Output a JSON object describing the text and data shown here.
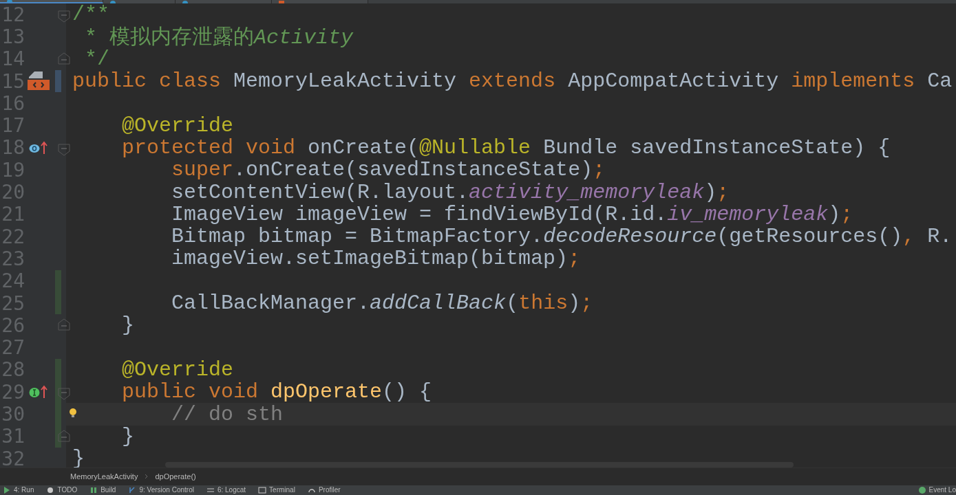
{
  "editor_tabs": [
    {
      "selected": true,
      "kind": "java"
    },
    {
      "selected": false,
      "kind": "java"
    },
    {
      "selected": false,
      "kind": "java"
    },
    {
      "selected": false,
      "kind": "xml"
    }
  ],
  "lines": [
    {
      "number": "12",
      "kind": "code",
      "added": false,
      "modified": false,
      "fold_start": true,
      "fold_end": false,
      "current": false,
      "tokens": [
        {
          "text": "/**",
          "kind": "doc"
        }
      ]
    },
    {
      "number": "13",
      "kind": "code",
      "added": false,
      "modified": false,
      "fold_start": false,
      "fold_end": false,
      "current": false,
      "tokens": [
        {
          "text": " * 模拟内存泄露的",
          "kind": "doc"
        },
        {
          "text": "Activity",
          "kind": "doc-italic"
        }
      ]
    },
    {
      "number": "14",
      "kind": "code",
      "added": false,
      "modified": false,
      "fold_start": false,
      "fold_end": true,
      "current": false,
      "tokens": [
        {
          "text": " */",
          "kind": "doc"
        }
      ]
    },
    {
      "number": "15",
      "kind": "class",
      "added": false,
      "modified": true,
      "fold_start": false,
      "fold_end": false,
      "current": false,
      "tokens": [
        {
          "text": "public class ",
          "kind": "keyword"
        },
        {
          "text": "MemoryLeakActivity ",
          "kind": "plain"
        },
        {
          "text": "extends ",
          "kind": "keyword"
        },
        {
          "text": "AppCompatActivity ",
          "kind": "plain"
        },
        {
          "text": "implements ",
          "kind": "keyword"
        },
        {
          "text": "Ca",
          "kind": "plain"
        }
      ]
    },
    {
      "number": "16",
      "kind": "code",
      "added": false,
      "modified": false,
      "fold_start": false,
      "fold_end": false,
      "current": false
    },
    {
      "number": "17",
      "kind": "code",
      "added": false,
      "modified": false,
      "fold_start": false,
      "fold_end": false,
      "current": false,
      "tokens": [
        {
          "text": "    @Override",
          "kind": "annotation"
        }
      ]
    },
    {
      "number": "18",
      "kind": "overriding",
      "added": false,
      "modified": false,
      "fold_start": true,
      "fold_end": false,
      "current": false,
      "tokens": [
        {
          "text": "    protected void ",
          "kind": "keyword"
        },
        {
          "text": "onCreate(",
          "kind": "plain"
        },
        {
          "text": "@Nullable ",
          "kind": "annotation"
        },
        {
          "text": "Bundle savedInstanceState) {",
          "kind": "plain"
        }
      ]
    },
    {
      "number": "19",
      "kind": "code",
      "added": false,
      "modified": false,
      "fold_start": false,
      "fold_end": false,
      "current": false,
      "tokens": [
        {
          "text": "        super",
          "kind": "keyword"
        },
        {
          "text": ".onCreate(savedInstanceState)",
          "kind": "plain"
        },
        {
          "text": ";",
          "kind": "keyword"
        }
      ]
    },
    {
      "number": "20",
      "kind": "code",
      "added": false,
      "modified": false,
      "fold_start": false,
      "fold_end": false,
      "current": false,
      "tokens": [
        {
          "text": "        setContentView(R.layout.",
          "kind": "plain"
        },
        {
          "text": "activity_memoryleak",
          "kind": "field"
        },
        {
          "text": ")",
          "kind": "plain"
        },
        {
          "text": ";",
          "kind": "keyword"
        }
      ]
    },
    {
      "number": "21",
      "kind": "code",
      "added": false,
      "modified": false,
      "fold_start": false,
      "fold_end": false,
      "current": false,
      "tokens": [
        {
          "text": "        ImageView imageView = findViewById(R.id.",
          "kind": "plain"
        },
        {
          "text": "iv_memoryleak",
          "kind": "field"
        },
        {
          "text": ")",
          "kind": "plain"
        },
        {
          "text": ";",
          "kind": "keyword"
        }
      ]
    },
    {
      "number": "22",
      "kind": "code",
      "added": false,
      "modified": false,
      "fold_start": false,
      "fold_end": false,
      "current": false,
      "tokens": [
        {
          "text": "        Bitmap bitmap = BitmapFactory.",
          "kind": "plain"
        },
        {
          "text": "decodeResource",
          "kind": "static"
        },
        {
          "text": "(getResources()",
          "kind": "plain"
        },
        {
          "text": ", ",
          "kind": "keyword"
        },
        {
          "text": "R.",
          "kind": "plain"
        }
      ]
    },
    {
      "number": "23",
      "kind": "code",
      "added": false,
      "modified": false,
      "fold_start": false,
      "fold_end": false,
      "current": false,
      "tokens": [
        {
          "text": "        imageView.setImageBitmap(bitmap)",
          "kind": "plain"
        },
        {
          "text": ";",
          "kind": "keyword"
        }
      ]
    },
    {
      "number": "24",
      "kind": "code",
      "added": true,
      "modified": false,
      "fold_start": false,
      "fold_end": false,
      "current": false
    },
    {
      "number": "25",
      "kind": "code",
      "added": true,
      "modified": false,
      "fold_start": false,
      "fold_end": false,
      "current": false,
      "tokens": [
        {
          "text": "        CallBackManager.",
          "kind": "plain"
        },
        {
          "text": "addCallBack",
          "kind": "static"
        },
        {
          "text": "(",
          "kind": "plain"
        },
        {
          "text": "this",
          "kind": "keyword"
        },
        {
          "text": ")",
          "kind": "plain"
        },
        {
          "text": ";",
          "kind": "keyword"
        }
      ]
    },
    {
      "number": "26",
      "kind": "code",
      "added": false,
      "modified": false,
      "fold_start": false,
      "fold_end": true,
      "current": false,
      "tokens": [
        {
          "text": "    }",
          "kind": "plain"
        }
      ]
    },
    {
      "number": "27",
      "kind": "code",
      "added": false,
      "modified": false,
      "fold_start": false,
      "fold_end": false,
      "current": false
    },
    {
      "number": "28",
      "kind": "code",
      "added": true,
      "modified": false,
      "fold_start": false,
      "fold_end": false,
      "current": false,
      "tokens": [
        {
          "text": "    @Override",
          "kind": "annotation"
        }
      ]
    },
    {
      "number": "29",
      "kind": "implementing",
      "added": true,
      "modified": false,
      "fold_start": true,
      "fold_end": false,
      "current": false,
      "tokens": [
        {
          "text": "    public void ",
          "kind": "keyword"
        },
        {
          "text": "dpOperate",
          "kind": "method"
        },
        {
          "text": "() {",
          "kind": "plain"
        }
      ]
    },
    {
      "number": "30",
      "kind": "code",
      "added": true,
      "modified": false,
      "fold_start": false,
      "fold_end": false,
      "current": true,
      "tokens": [
        {
          "text": "        // do sth",
          "kind": "comment"
        }
      ]
    },
    {
      "number": "31",
      "kind": "code",
      "added": true,
      "modified": false,
      "fold_start": false,
      "fold_end": true,
      "current": false,
      "tokens": [
        {
          "text": "    }",
          "kind": "plain"
        }
      ]
    },
    {
      "number": "32",
      "kind": "code",
      "added": false,
      "modified": false,
      "fold_start": false,
      "fold_end": false,
      "current": false,
      "tokens": [
        {
          "text": "}",
          "kind": "plain"
        }
      ]
    }
  ],
  "breadcrumbs": [
    "MemoryLeakActivity",
    "dpOperate()"
  ],
  "tool_windows": [
    {
      "label": "4: Run"
    },
    {
      "label": "TODO"
    },
    {
      "label": "Build"
    },
    {
      "label": "9: Version Control"
    },
    {
      "label": "6: Logcat"
    },
    {
      "label": "Terminal"
    },
    {
      "label": "Profiler"
    }
  ],
  "event_log": {
    "label": "Event Lo"
  }
}
